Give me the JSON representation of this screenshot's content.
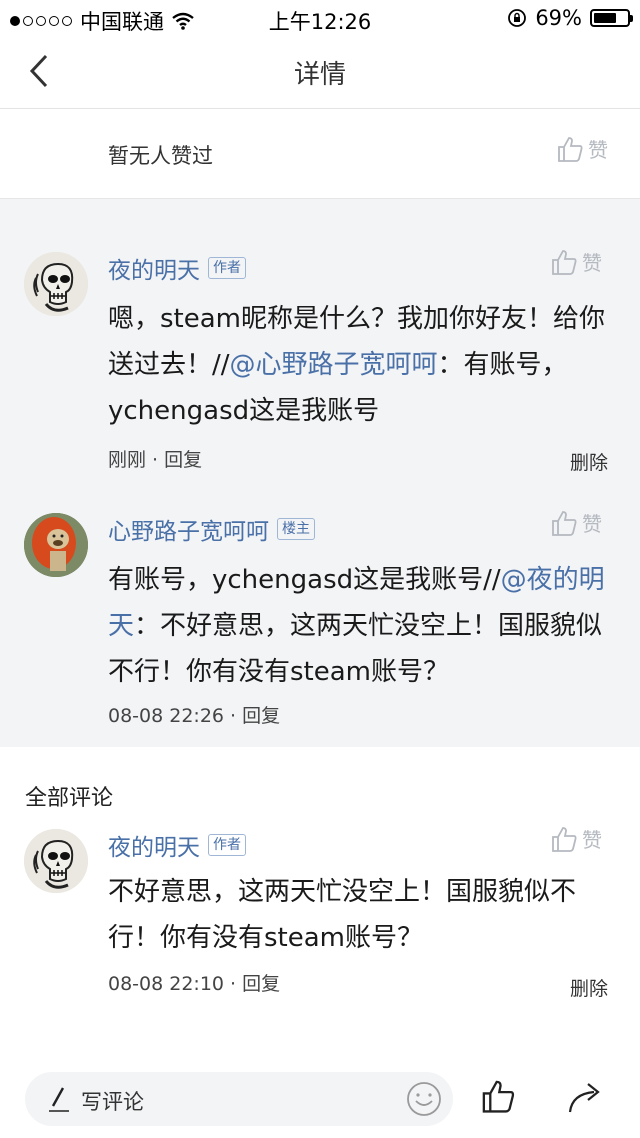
{
  "status_bar": {
    "carrier": "中国联通",
    "time": "上午12:26",
    "battery_percent": "69%",
    "battery_level": 0.69
  },
  "nav": {
    "title": "详情",
    "back_icon": "chevron-left-icon"
  },
  "likes": {
    "text": "暂无人赞过",
    "like_label": "赞"
  },
  "thread": [
    {
      "name": "夜的明天",
      "badge": "作者",
      "body_parts": [
        {
          "text": "嗯，steam昵称是什么？我加你好友！给你送过去！//",
          "mention": false
        },
        {
          "text": "@心野路子宽呵呵",
          "mention": true
        },
        {
          "text": "：有账号，ychengasd这是我账号",
          "mention": false
        }
      ],
      "time": "刚刚",
      "reply": "回复",
      "delete": "删除",
      "like_label": "赞"
    },
    {
      "name": "心野路子宽呵呵",
      "badge": "楼主",
      "body_parts": [
        {
          "text": "有账号，ychengasd这是我账号//",
          "mention": false
        },
        {
          "text": "@夜的明天",
          "mention": true
        },
        {
          "text": "：不好意思，这两天忙没空上！国服貌似不行！你有没有steam账号？",
          "mention": false
        }
      ],
      "time": "08-08 22:26",
      "reply": "回复",
      "like_label": "赞"
    }
  ],
  "all_comments": {
    "title": "全部评论",
    "items": [
      {
        "name": "夜的明天",
        "badge": "作者",
        "body": "不好意思，这两天忙没空上！国服貌似不行！你有没有steam账号？",
        "time": "08-08 22:10",
        "reply": "回复",
        "delete": "删除",
        "like_label": "赞"
      }
    ]
  },
  "bottom_bar": {
    "write_placeholder": "写评论"
  },
  "colors": {
    "link": "#4a70a8",
    "thread_bg": "#f3f4f6",
    "muted": "#b5b9c0"
  }
}
